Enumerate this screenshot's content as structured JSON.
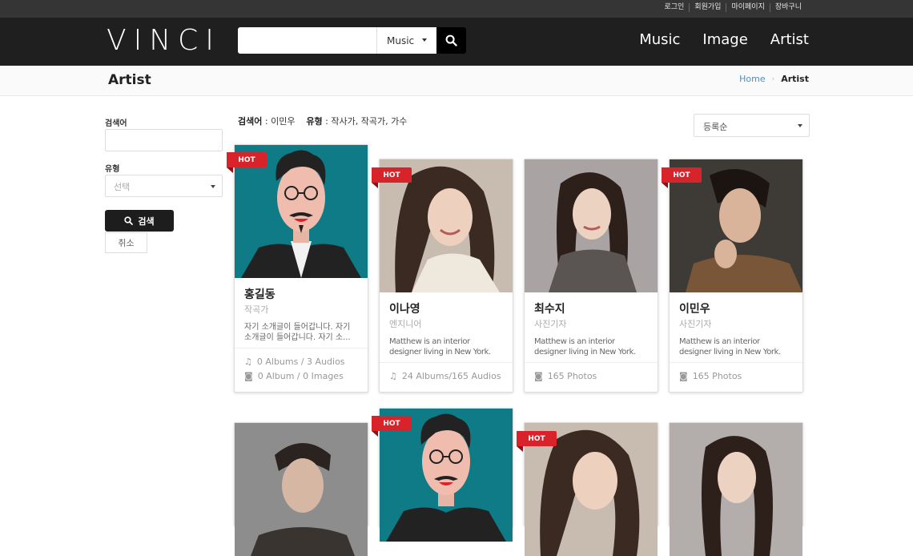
{
  "util_links": [
    "로그인",
    "회원가입",
    "마이페이지",
    "장바구니"
  ],
  "brand": "VINCI",
  "search": {
    "placeholder": "",
    "category": "Music"
  },
  "nav": [
    "Music",
    "Image",
    "Artist"
  ],
  "page": {
    "title": "Artist",
    "breadcrumb_home": "Home",
    "breadcrumb_current": "Artist"
  },
  "filter": {
    "keyword_label": "검색어",
    "type_label": "유형",
    "type_placeholder": "선택",
    "search_button": "검색",
    "cancel_button": "취소"
  },
  "summary": {
    "keyword_label": "검색어",
    "keyword_value": " : 이민우",
    "type_label": "유형",
    "type_value": " : 작사가, 작곡가, 가수"
  },
  "sort": {
    "selected": "등록순"
  },
  "hot_label": "HOT",
  "colors": {
    "accent": "#d9232a",
    "header": "#1f1f1f",
    "link": "#4a90c8"
  },
  "cards": [
    {
      "name": "홍길동",
      "role": "작곡가",
      "desc": "자기 소개글이 들어갑니다. 자기 소개글이 들어갑니다. 자기 소...",
      "stat1": "0 Albums / 3 Audios",
      "stat2": "0 Album / 0 Images",
      "hot": true
    },
    {
      "name": "이나영",
      "role": "엔지니어",
      "desc": "Matthew is an interior designer living in New York.",
      "stat1": "24 Albums/165 Audios",
      "hot": true
    },
    {
      "name": "최수지",
      "role": "사진기자",
      "desc": "Matthew is an interior designer living in New York.",
      "stat1": "165 Photos",
      "hot": false
    },
    {
      "name": "이민우",
      "role": "사진기자",
      "desc": "Matthew is an interior designer living in New York.",
      "stat1": "165 Photos",
      "hot": true
    }
  ]
}
